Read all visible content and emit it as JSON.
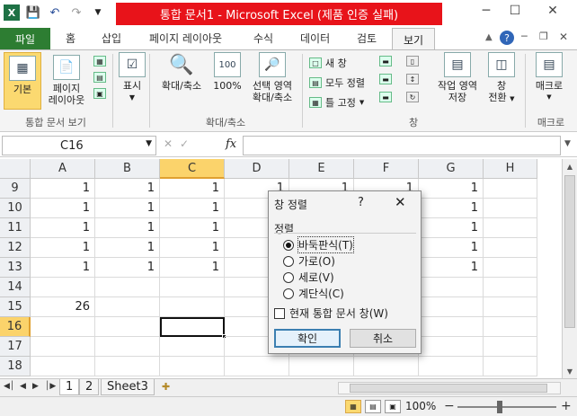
{
  "title": "통합 문서1 - Microsoft Excel (제품 인증 실패)",
  "qat": {
    "save_icon": "save-icon",
    "undo_icon": "undo-icon",
    "redo_icon": "redo-icon",
    "customize_icon": "customize-icon"
  },
  "window": {
    "minimize": "─",
    "maximize": "☐",
    "close": "✕"
  },
  "tabs": [
    "파일",
    "홈",
    "삽입",
    "페이지 레이아웃",
    "수식",
    "데이터",
    "검토",
    "보기"
  ],
  "ribbon": {
    "groups": {
      "views": {
        "label": "통합 문서 보기",
        "normal": "기본",
        "page_layout_1": "페이지",
        "page_layout_2": "레이아웃"
      },
      "show": {
        "label": "표시"
      },
      "zoom": {
        "label": "확대/축소",
        "zoom": "확대/축소",
        "zoom100": "100%",
        "sel_1": "선택 영역",
        "sel_2": "확대/축소"
      },
      "window": {
        "label": "창",
        "new": "새 창",
        "arrange": "모두 정렬",
        "freeze": "틀 고정",
        "save_ws_1": "작업 영역",
        "save_ws_2": "저장",
        "switch_1": "창",
        "switch_2": "전환"
      },
      "macro": {
        "label": "매크로",
        "btn": "매크로"
      }
    }
  },
  "formula": {
    "name_box": "C16",
    "fx": "fx",
    "value": ""
  },
  "columns": [
    "A",
    "B",
    "C",
    "D",
    "E",
    "F",
    "G",
    "H"
  ],
  "selected_column": "C",
  "rows": [
    {
      "n": "9",
      "cells": [
        "1",
        "1",
        "1",
        "1",
        "1",
        "1",
        "1",
        ""
      ]
    },
    {
      "n": "10",
      "cells": [
        "1",
        "1",
        "1",
        "",
        "",
        "",
        "1",
        ""
      ]
    },
    {
      "n": "11",
      "cells": [
        "1",
        "1",
        "1",
        "",
        "",
        "",
        "1",
        ""
      ]
    },
    {
      "n": "12",
      "cells": [
        "1",
        "1",
        "1",
        "",
        "",
        "",
        "1",
        ""
      ]
    },
    {
      "n": "13",
      "cells": [
        "1",
        "1",
        "1",
        "",
        "",
        "",
        "1",
        ""
      ]
    },
    {
      "n": "14",
      "cells": [
        "",
        "",
        "",
        "",
        "",
        "",
        "",
        ""
      ]
    },
    {
      "n": "15",
      "cells": [
        "26",
        "",
        "",
        "",
        "",
        "",
        "",
        ""
      ]
    },
    {
      "n": "16",
      "cells": [
        "",
        "",
        "",
        "",
        "",
        "",
        "",
        ""
      ]
    },
    {
      "n": "17",
      "cells": [
        "",
        "",
        "",
        "",
        "",
        "",
        "",
        ""
      ]
    },
    {
      "n": "18",
      "cells": [
        "",
        "",
        "",
        "",
        "",
        "",
        "",
        ""
      ]
    }
  ],
  "selected_row": "16",
  "sheets": [
    "1",
    "2",
    "Sheet3"
  ],
  "status": {
    "zoom": "100%"
  },
  "dialog": {
    "title": "창 정렬",
    "help": "?",
    "close": "✕",
    "section": "정렬",
    "options": [
      "바둑판식(T)",
      "가로(O)",
      "세로(V)",
      "계단식(C)"
    ],
    "selected_option": 0,
    "checkbox": "현재 통합 문서 창(W)",
    "ok": "확인",
    "cancel": "취소"
  }
}
